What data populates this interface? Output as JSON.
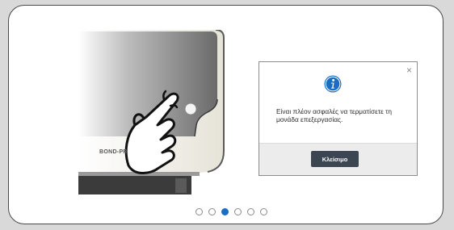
{
  "illustration": {
    "brand_text": "BOND-PR"
  },
  "dialog": {
    "close_glyph": "×",
    "icon": "info-icon",
    "message": "Είναι πλέον ασφαλές να τερματίσετε τη μονάδα επεξεργασίας.",
    "button_label": "Κλείσιμο"
  },
  "pagination": {
    "count": 6,
    "active_index": 2
  },
  "colors": {
    "accent": "#1a6dc2",
    "button_bg": "#3c4652"
  }
}
